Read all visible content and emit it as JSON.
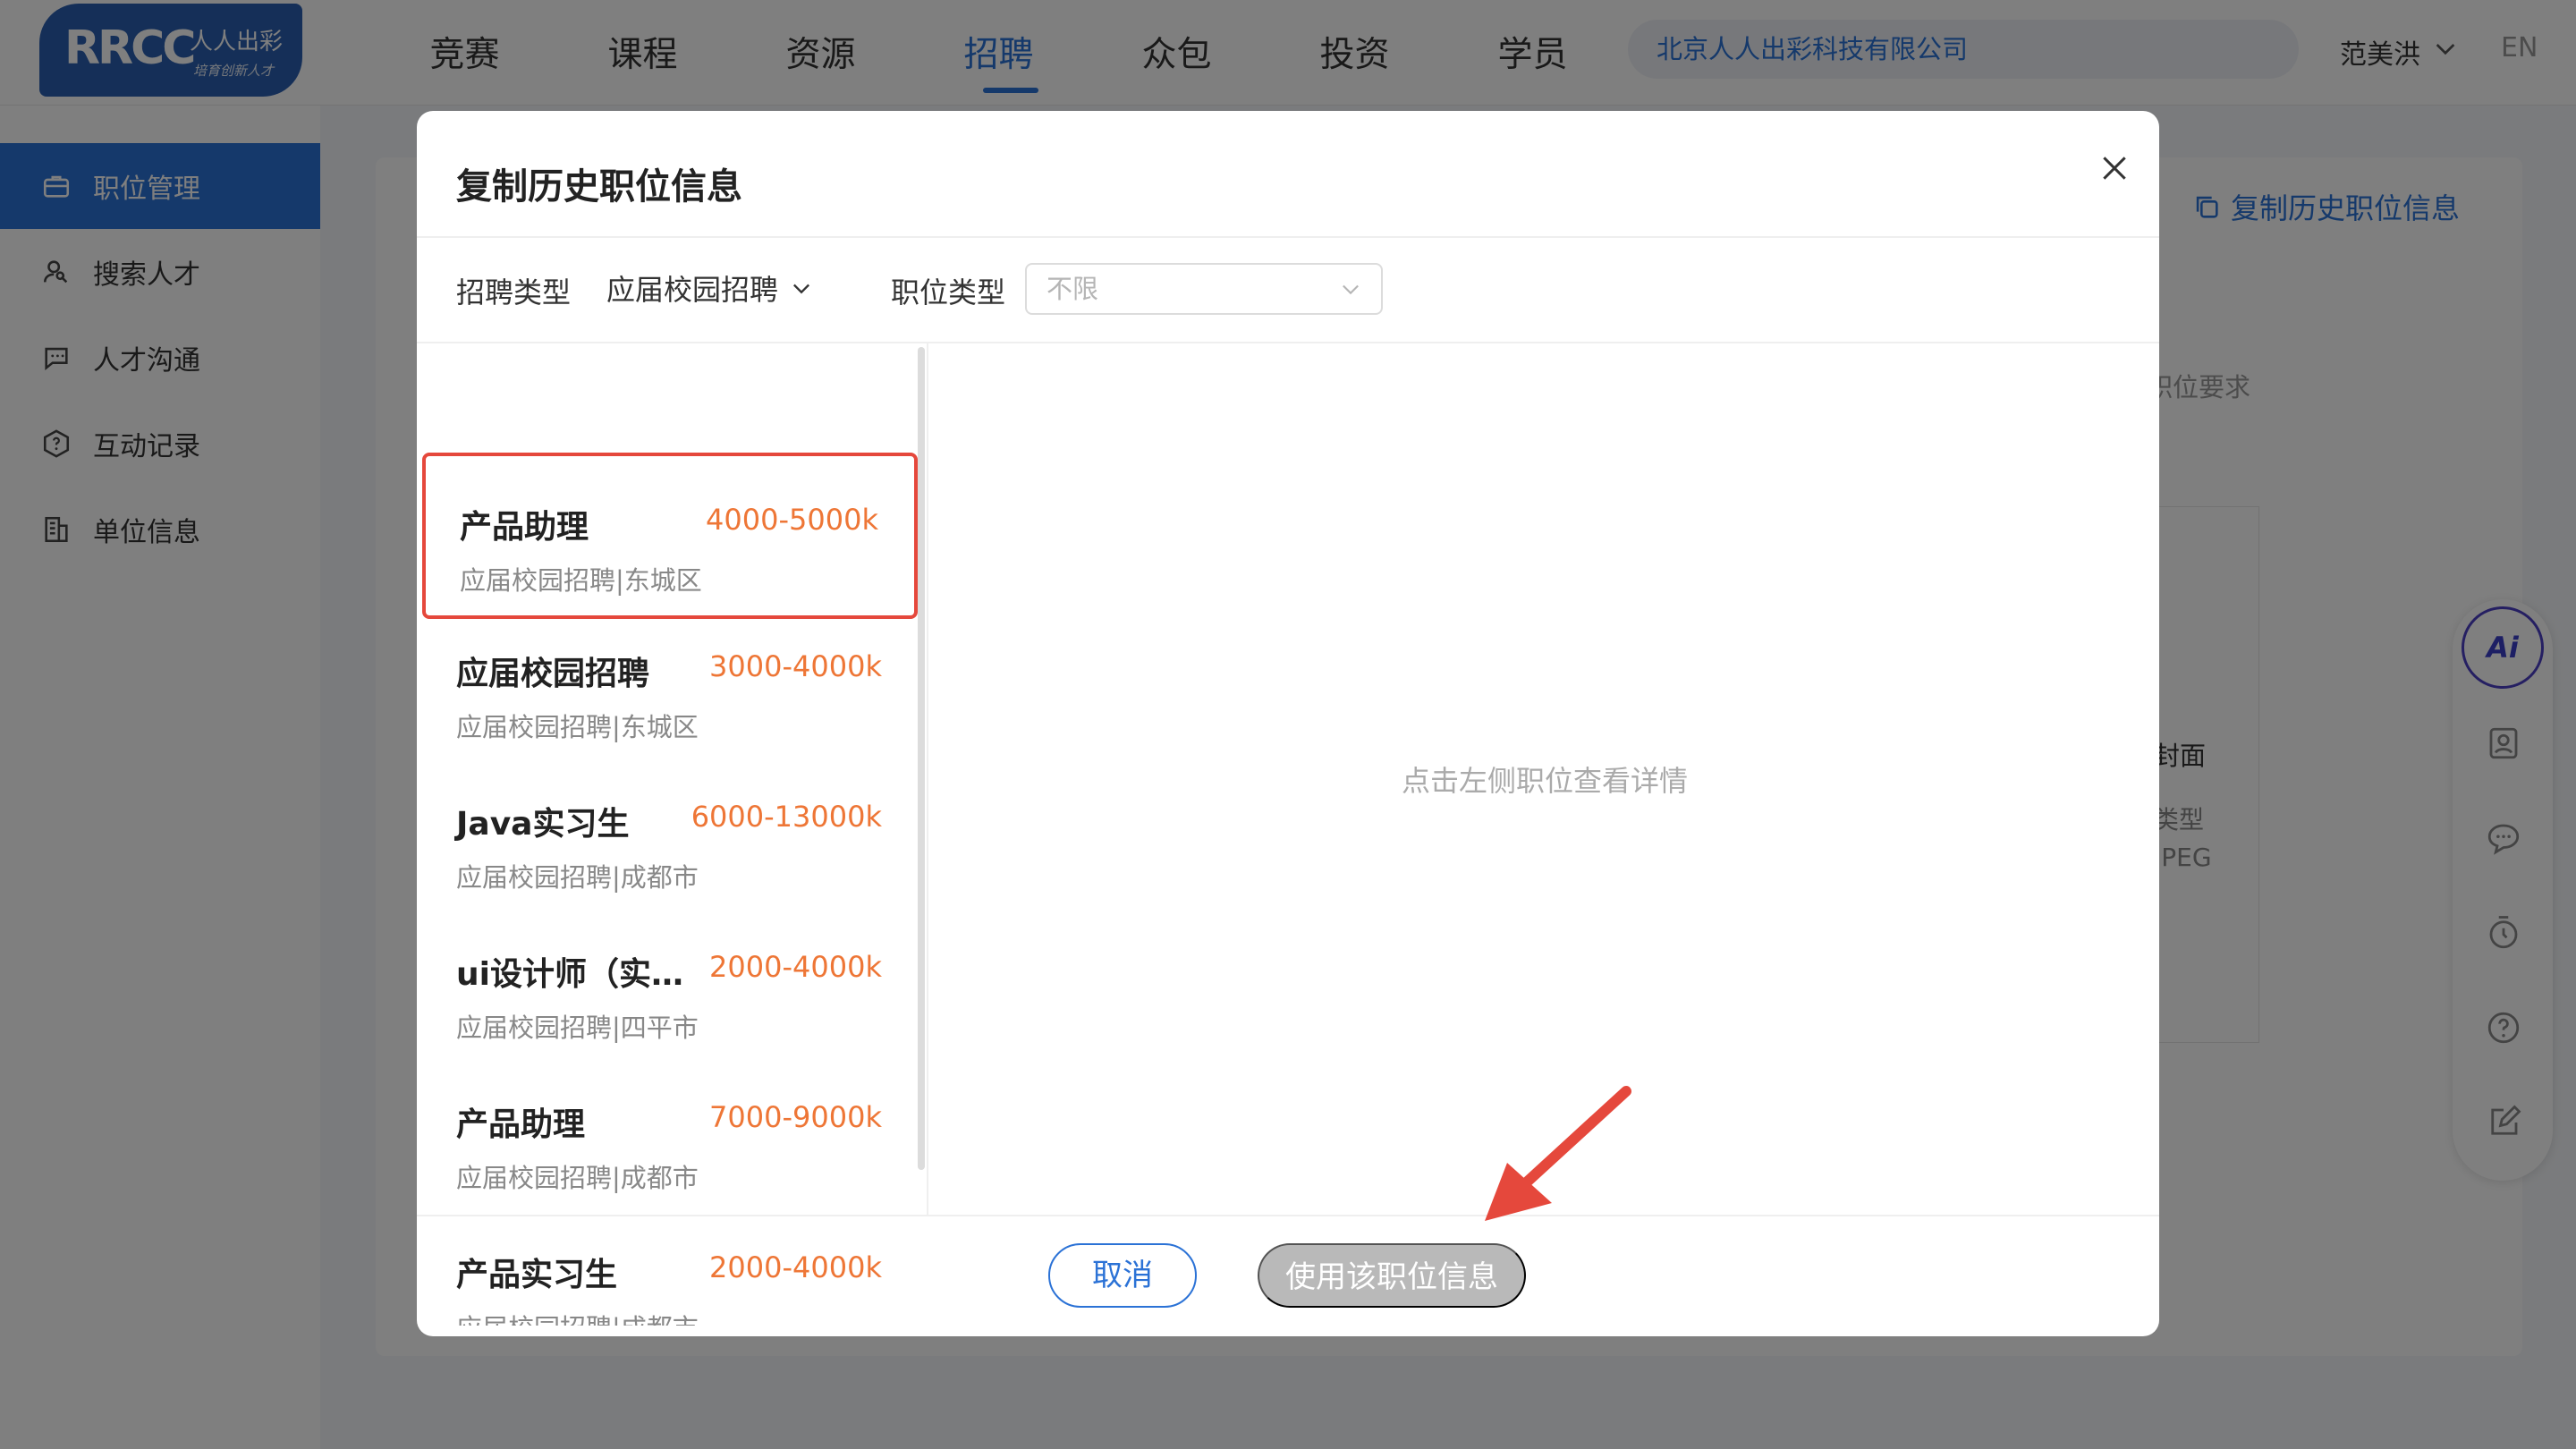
{
  "header": {
    "logo_mark": "RRCC",
    "logo_cn": "人人出彩",
    "logo_slogan": "培育创新人才",
    "nav": [
      "竞赛",
      "课程",
      "资源",
      "招聘",
      "众包",
      "投资",
      "学员"
    ],
    "active_nav": "招聘",
    "company": "北京人人出彩科技有限公司",
    "user": "范美洪",
    "lang": "EN"
  },
  "sidebar": {
    "items": [
      {
        "label": "职位管理",
        "icon": "briefcase-icon"
      },
      {
        "label": "搜索人才",
        "icon": "user-search-icon"
      },
      {
        "label": "人才沟通",
        "icon": "chat-icon"
      },
      {
        "label": "互动记录",
        "icon": "hexagon-question-icon"
      },
      {
        "label": "单位信息",
        "icon": "building-icon"
      }
    ],
    "active": "职位管理"
  },
  "background": {
    "copy_link": "复制历史职位信息",
    "req_text": "职位要求",
    "cover_text": "封面",
    "type_text": "类型",
    "jpeg_text": "JPEG"
  },
  "float_toolbar": {
    "ai_label": "Ai",
    "icons": [
      "portrait-icon",
      "comment-icon",
      "timer-icon",
      "help-icon",
      "edit-icon"
    ]
  },
  "modal": {
    "title": "复制历史职位信息",
    "filter1_label": "招聘类型",
    "filter1_value": "应届校园招聘",
    "filter2_label": "职位类型",
    "filter2_placeholder": "不限",
    "jobs": [
      {
        "name": "产品助理",
        "salary": "4000-5000k",
        "meta": "应届校园招聘|东城区",
        "selected": true
      },
      {
        "name": "应届校园招聘",
        "salary": "3000-4000k",
        "meta": "应届校园招聘|东城区"
      },
      {
        "name": "Java实习生",
        "salary": "6000-13000k",
        "meta": "应届校园招聘|成都市"
      },
      {
        "name": "ui设计师（实…",
        "salary": "2000-4000k",
        "meta": "应届校园招聘|四平市"
      },
      {
        "name": "产品助理",
        "salary": "7000-9000k",
        "meta": "应届校园招聘|成都市"
      },
      {
        "name": "产品实习生",
        "salary": "2000-4000k",
        "meta": "应届校园招聘|成都市"
      }
    ],
    "detail_hint": "点击左侧职位查看详情",
    "cancel_label": "取消",
    "use_label": "使用该职位信息"
  },
  "colors": {
    "brand_blue": "#2b72d6",
    "salary_orange": "#ee7636",
    "highlight_red": "#e5483c",
    "disabled_gray": "#b9b9b9"
  }
}
